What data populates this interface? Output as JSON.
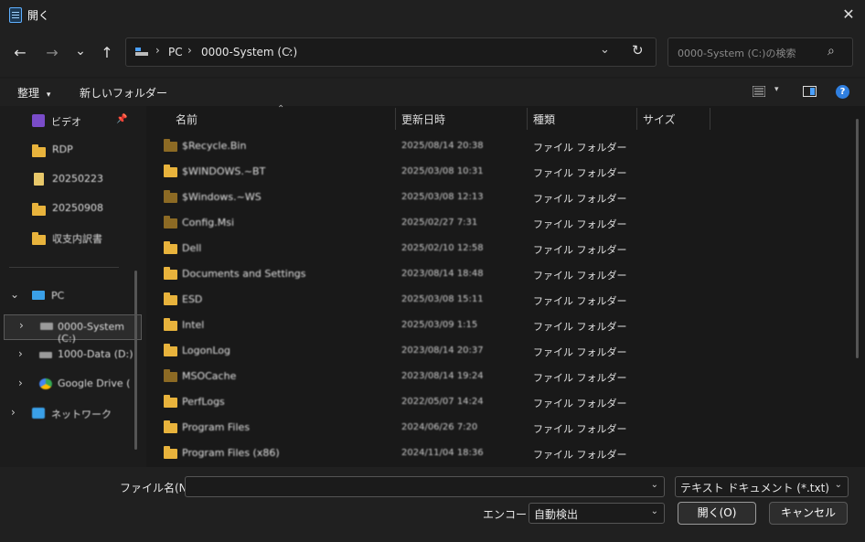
{
  "window": {
    "title": "開く",
    "close_glyph": "✕"
  },
  "nav": {
    "back_glyph": "←",
    "forward_glyph": "→",
    "recent_glyph": "⌄",
    "up_glyph": "↑",
    "breadcrumb": [
      "PC",
      "0000-System (C:)"
    ],
    "breadcrumb_sep": "›",
    "dropdown_glyph": "⌄",
    "refresh_glyph": "↻",
    "search_placeholder": "0000-System (C:)の検索",
    "search_glyph": "⌕"
  },
  "toolbar": {
    "organize_label": "整理",
    "organize_glyph": "▾",
    "new_folder_label": "新しいフォルダー",
    "view_glyph": "▾",
    "help_glyph": "?"
  },
  "sidebar": {
    "items": [
      {
        "label": "ビデオ",
        "icon": "video-icon"
      },
      {
        "label": "RDP",
        "icon": "folder-icon"
      },
      {
        "label": "20250223",
        "icon": "document-icon"
      },
      {
        "label": "20250908",
        "icon": "folder-icon"
      },
      {
        "label": "収支内訳書",
        "icon": "folder-icon"
      }
    ],
    "tree": [
      {
        "label": "PC",
        "icon": "pc-icon",
        "expander": "⌄"
      },
      {
        "label": "0000-System (C:)",
        "icon": "drive-icon",
        "expander": "›"
      },
      {
        "label": "1000-Data (D:)",
        "icon": "drive-icon",
        "expander": "›"
      },
      {
        "label": "Google Drive (",
        "icon": "google-drive-icon",
        "expander": "›"
      },
      {
        "label": "ネットワーク",
        "icon": "network-icon",
        "expander": "›"
      }
    ],
    "pin_glyph": "📌"
  },
  "columns": {
    "name": "名前",
    "date": "更新日時",
    "type": "種類",
    "size": "サイズ",
    "sort_glyph": "⌃"
  },
  "files": [
    {
      "name": "$Recycle.Bin",
      "date": "2025/08/14 20:38",
      "type": "ファイル フォルダー",
      "dim": true
    },
    {
      "name": "$WINDOWS.~BT",
      "date": "2025/03/08 10:31",
      "type": "ファイル フォルダー",
      "dim": false
    },
    {
      "name": "$Windows.~WS",
      "date": "2025/03/08 12:13",
      "type": "ファイル フォルダー",
      "dim": true
    },
    {
      "name": "Config.Msi",
      "date": "2025/02/27 7:31",
      "type": "ファイル フォルダー",
      "dim": true
    },
    {
      "name": "Dell",
      "date": "2025/02/10 12:58",
      "type": "ファイル フォルダー",
      "dim": false
    },
    {
      "name": "Documents and Settings",
      "date": "2023/08/14 18:48",
      "type": "ファイル フォルダー",
      "dim": false
    },
    {
      "name": "ESD",
      "date": "2025/03/08 15:11",
      "type": "ファイル フォルダー",
      "dim": false
    },
    {
      "name": "Intel",
      "date": "2025/03/09 1:15",
      "type": "ファイル フォルダー",
      "dim": false
    },
    {
      "name": "LogonLog",
      "date": "2023/08/14 20:37",
      "type": "ファイル フォルダー",
      "dim": false
    },
    {
      "name": "MSOCache",
      "date": "2023/08/14 19:24",
      "type": "ファイル フォルダー",
      "dim": true
    },
    {
      "name": "PerfLogs",
      "date": "2022/05/07 14:24",
      "type": "ファイル フォルダー",
      "dim": false
    },
    {
      "name": "Program Files",
      "date": "2024/06/26 7:20",
      "type": "ファイル フォルダー",
      "dim": false
    },
    {
      "name": "Program Files (x86)",
      "date": "2024/11/04 18:36",
      "type": "ファイル フォルダー",
      "dim": false
    }
  ],
  "footer": {
    "filename_label": "ファイル名(N):",
    "filename_value": "",
    "filetype_value": "テキスト ドキュメント (*.txt)",
    "encoding_label": "エンコード:",
    "encoding_value": "自動検出",
    "open_label": "開く(O)",
    "cancel_label": "キャンセル",
    "chevron": "⌄"
  }
}
